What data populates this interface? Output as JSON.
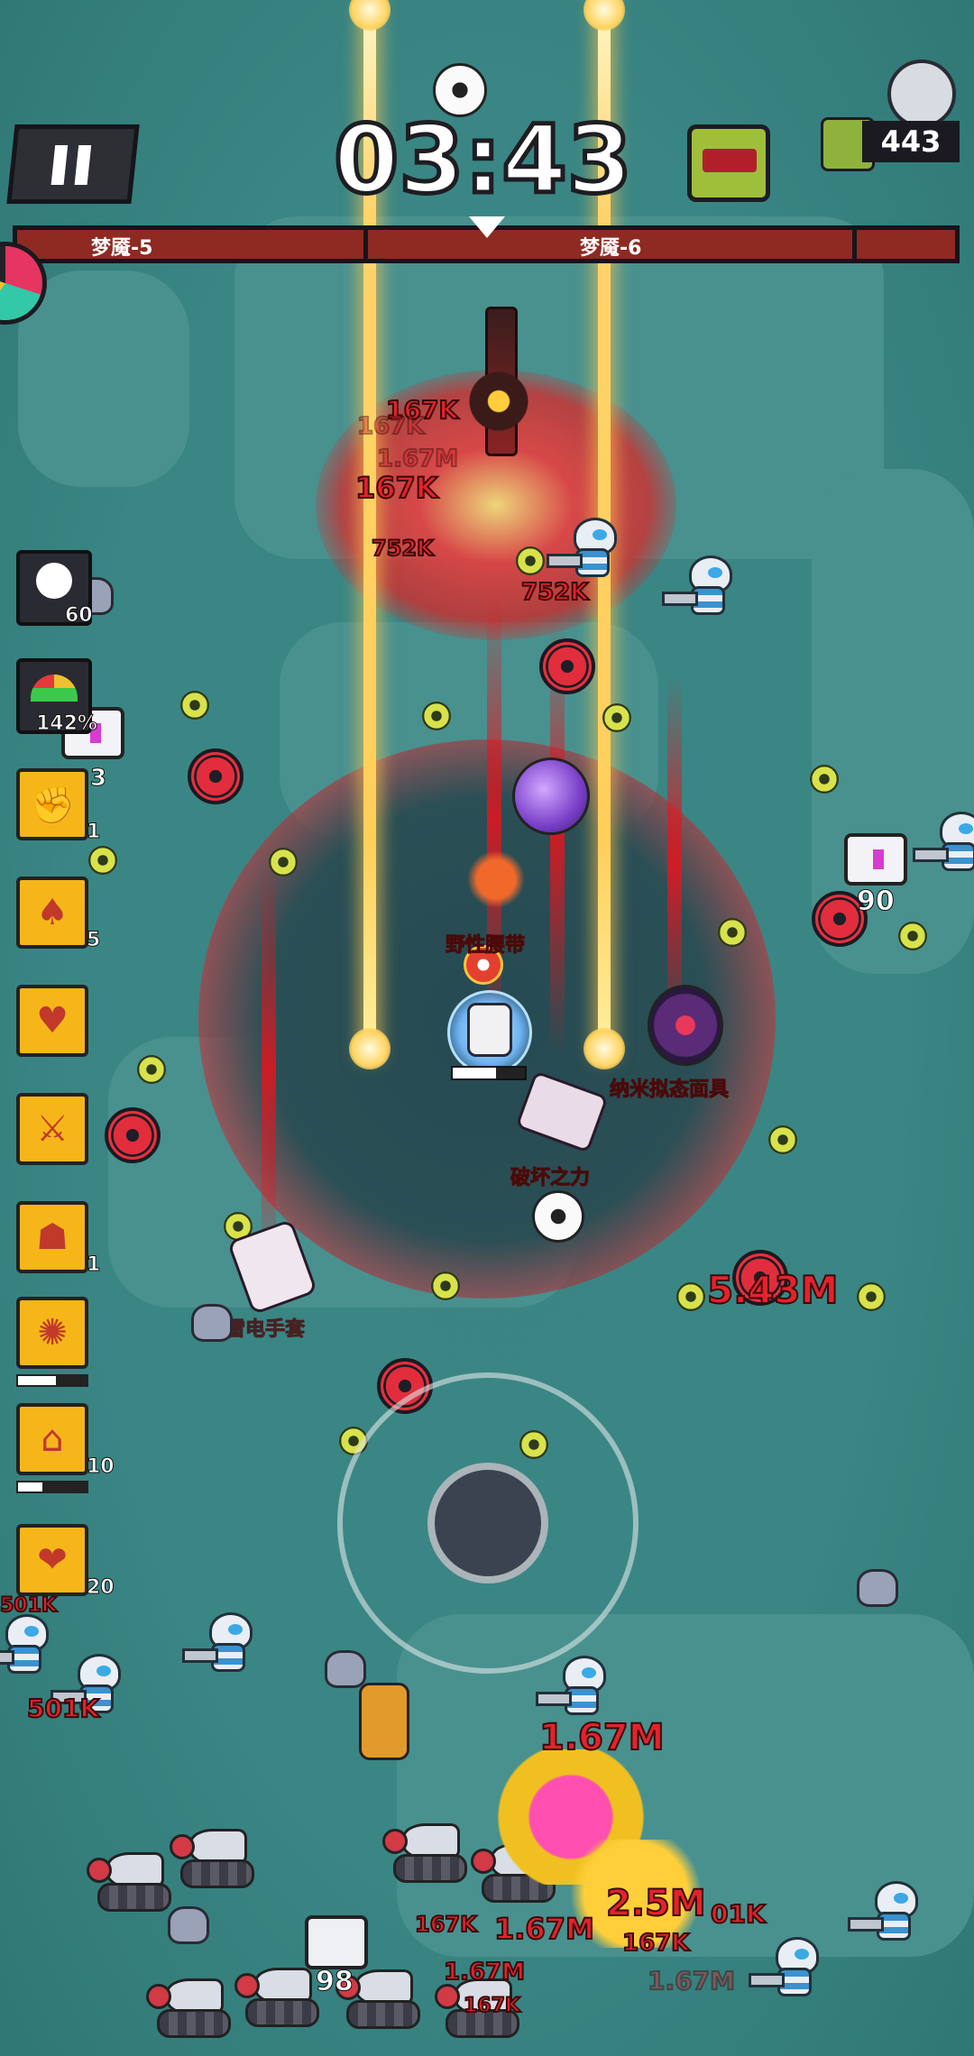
{
  "hud": {
    "timer": "03:43",
    "kill_count": "443",
    "pause_icon": "pause-icon",
    "boss_icon": "angry-robot-boss-icon",
    "kill_icon": "dead-zombie-icon",
    "chest_icon": "treasure-chest-icon",
    "wave_bar": {
      "left_label": "梦魇-5",
      "right_label": "梦魇-6"
    }
  },
  "status": {
    "skull_count": "60",
    "speed_percent": "142%"
  },
  "skills": [
    {
      "icon": "fire-fist-icon",
      "count": "1"
    },
    {
      "icon": "playing-card-icon",
      "count": "5"
    },
    {
      "icon": "heart-shield-icon",
      "count": ""
    },
    {
      "icon": "sword-icon",
      "count": ""
    },
    {
      "icon": "hooded-figure-icon",
      "count": "1"
    },
    {
      "icon": "explosion-clock-icon",
      "count": "",
      "progress": 0.55
    },
    {
      "icon": "house-clock-icon",
      "count": "10",
      "progress": 0.35
    },
    {
      "icon": "eye-heart-icon",
      "count": "20"
    }
  ],
  "pickups": {
    "item_a": "野性腰带",
    "item_b": "纳米拟态面具",
    "item_c": "破坏之力",
    "item_d": "雷电手套"
  },
  "chests": {
    "left_count": "3",
    "right_count": "90",
    "bottom_count": "98"
  },
  "damage_numbers": {
    "d1": "167K",
    "d2": "167K",
    "d3": "1.67M",
    "d4": "167K",
    "d5": "752K",
    "d6": "752K",
    "d7": "5.43M",
    "d8": "1.67M",
    "d9": "2.5M",
    "d10": "1.67M",
    "d11": "167K",
    "d12": "1.67M",
    "d13": "167K",
    "d14": "501K",
    "d15": "501K",
    "d16": "01K",
    "d17": "1.67M",
    "d18": "167K"
  },
  "colors": {
    "hp_bar": "#8e2a22",
    "skill_tile": "#f6b61a",
    "damage_text": "#e3232c",
    "floor": "#3f8a88"
  }
}
